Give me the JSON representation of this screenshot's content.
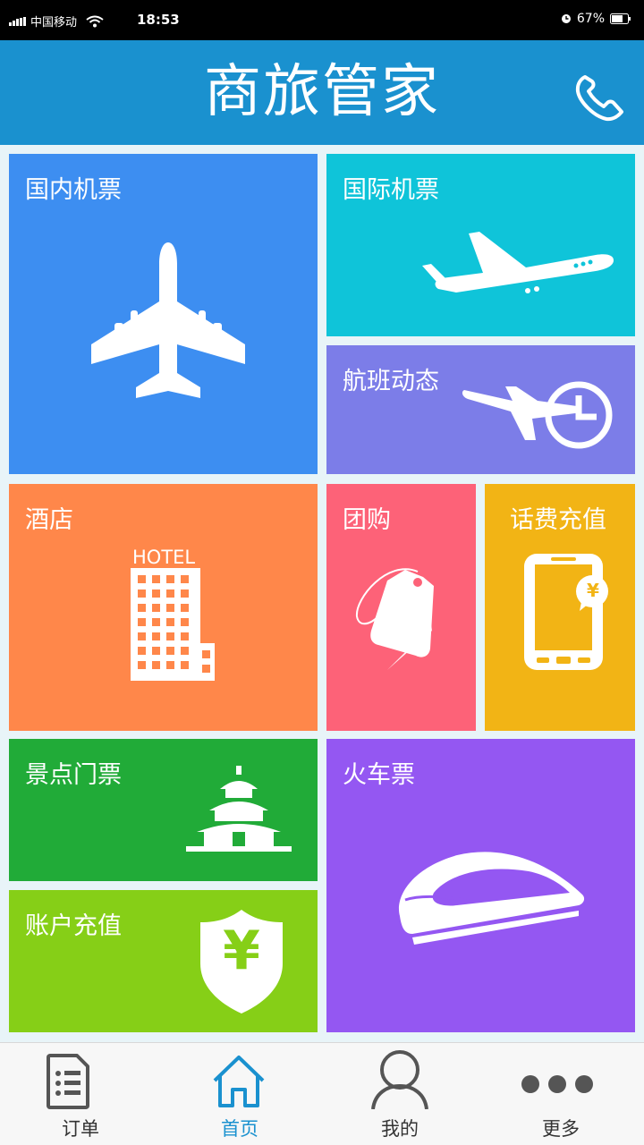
{
  "status_bar": {
    "carrier": "中国移动",
    "time": "18:53",
    "battery": "67%"
  },
  "header": {
    "title": "商旅管家",
    "phone_icon": "phone-icon"
  },
  "tiles": {
    "domestic_flights": {
      "label": "国内机票",
      "color": "#3d8ef1",
      "icon": "airplane-icon"
    },
    "international_flights": {
      "label": "国际机票",
      "color": "#0fc4d9",
      "icon": "airplane-takeoff-icon"
    },
    "flight_status": {
      "label": "航班动态",
      "color": "#7c7de8",
      "icon": "flight-clock-icon"
    },
    "hotel": {
      "label": "酒店",
      "color": "#ff874a",
      "icon_text": "HOTEL",
      "icon": "hotel-building-icon"
    },
    "group_buy": {
      "label": "团购",
      "color": "#fd6278",
      "icon": "price-tag-icon"
    },
    "phone_recharge": {
      "label": "话费充值",
      "color": "#f2b415",
      "icon": "mobile-yuan-icon",
      "icon_text": "¥"
    },
    "scenic_tickets": {
      "label": "景点门票",
      "color": "#21ab38",
      "icon": "temple-icon"
    },
    "account_recharge": {
      "label": "账户充值",
      "color": "#86cf17",
      "icon": "shield-yuan-icon",
      "icon_text": "¥"
    },
    "train_tickets": {
      "label": "火车票",
      "color": "#9457f2",
      "icon": "bullet-train-icon"
    }
  },
  "tabbar": {
    "items": [
      {
        "label": "订单",
        "icon": "document-list-icon"
      },
      {
        "label": "首页",
        "icon": "home-icon",
        "active": true
      },
      {
        "label": "我的",
        "icon": "person-icon"
      },
      {
        "label": "更多",
        "icon": "more-dots-icon"
      }
    ],
    "active_color": "#1a91cf"
  }
}
